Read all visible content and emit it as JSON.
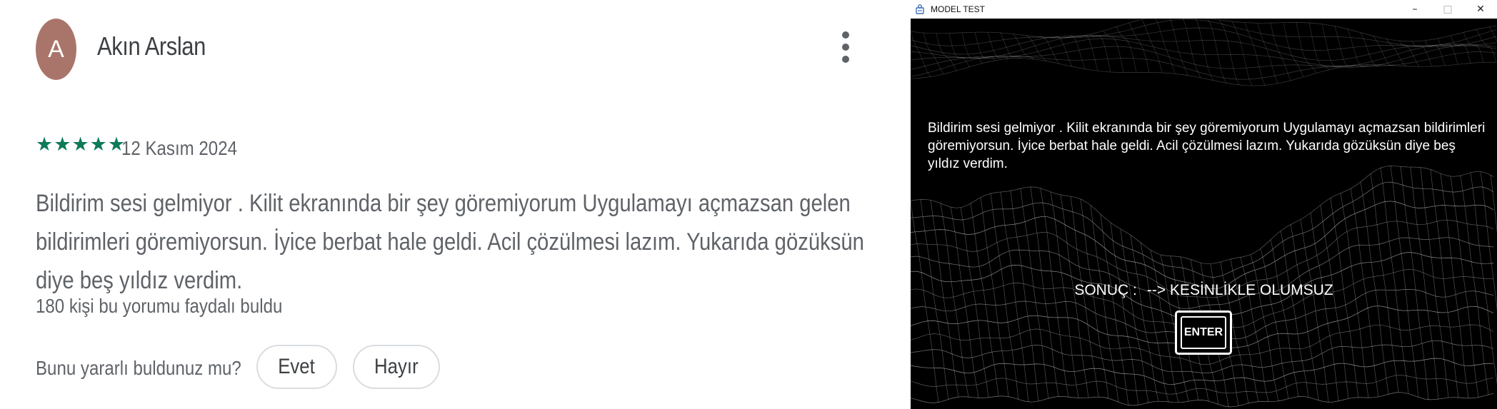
{
  "review": {
    "avatar_letter": "A",
    "reviewer_name": "Akın Arslan",
    "rating": 5,
    "star_glyph": "★",
    "date": "12 Kasım 2024",
    "body": "Bildirim sesi gelmiyor . Kilit ekranında bir şey göremiyorum Uygulamayı açmazsan gelen bildirimleri göremiyorsun. İyice berbat hale geldi. Acil çözülmesi lazım. Yukarıda gözüksün diye beş yıldız verdim.",
    "helpful_count_text": "180 kişi bu yorumu faydalı buldu",
    "helpful_question": "Bunu yararlı buldunuz mu?",
    "yes_label": "Evet",
    "no_label": "Hayır",
    "avatar_color": "#a9756a",
    "star_color": "#0d7a5a"
  },
  "window": {
    "title": "MODEL TEST",
    "minimize_glyph": "–",
    "maximize_glyph": "□",
    "close_glyph": "✕",
    "input_text": "Bildirim sesi gelmiyor . Kilit ekranında bir şey göremiyorum Uygulamayı açmazsan bildirimleri göremiyorsun. İyice berbat hale geldi. Acil çözülmesi lazım. Yukarıda gözüksün diye beş yıldız verdim.",
    "result_label": "SONUÇ :",
    "result_value": "--> KESİNLİKLE OLUMSUZ",
    "enter_label": "ENTER"
  }
}
